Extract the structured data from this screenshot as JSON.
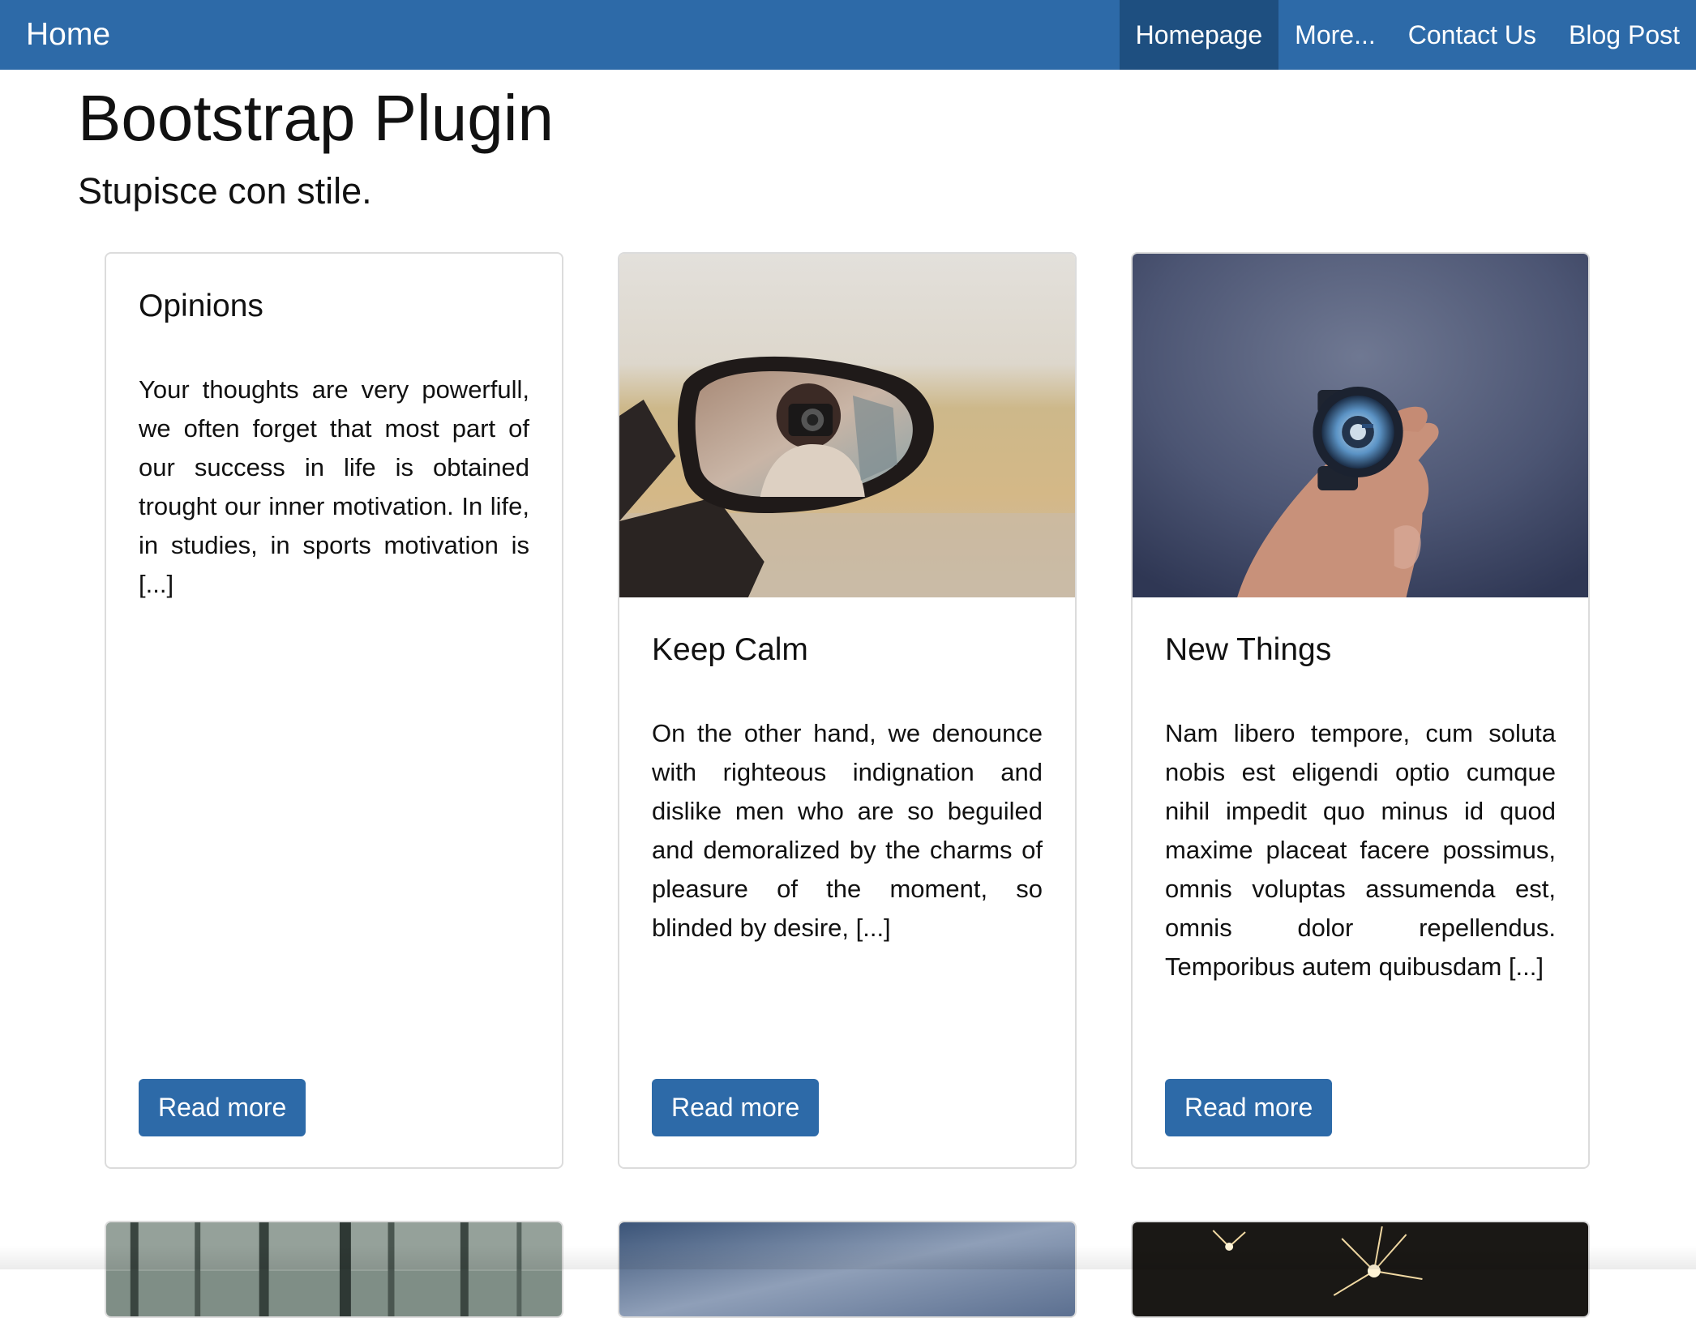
{
  "nav": {
    "brand": "Home",
    "items": [
      {
        "label": "Homepage",
        "active": true
      },
      {
        "label": "More...",
        "active": false
      },
      {
        "label": "Contact Us",
        "active": false
      },
      {
        "label": "Blog Post",
        "active": false
      }
    ]
  },
  "header": {
    "title": "Bootstrap Plugin",
    "subtitle": "Stupisce con stile."
  },
  "cards": [
    {
      "title": "Opinions",
      "text": "Your thoughts are very powerfull, we often forget that most part of our success in life is obtained trought our inner motivation. In life, in studies, in sports motivation is [...]",
      "button": "Read more"
    },
    {
      "title": "Keep Calm",
      "text": "On the other hand, we denounce with righteous indignation and dislike men who are so beguiled and demoralized by the charms of pleasure of the moment, so blinded by desire, [...]",
      "button": "Read more"
    },
    {
      "title": "New Things",
      "text": "Nam libero tempore, cum soluta nobis est eligendi optio cumque nihil impedit quo minus id quod maxime placeat facere possimus, omnis voluptas assumenda est, omnis dolor repellendus. Temporibus autem quibusdam [...]",
      "button": "Read more"
    }
  ],
  "colors": {
    "navbar": "#2d6aa8",
    "nav_active": "#1e4f80",
    "button": "#2d6aa8"
  }
}
